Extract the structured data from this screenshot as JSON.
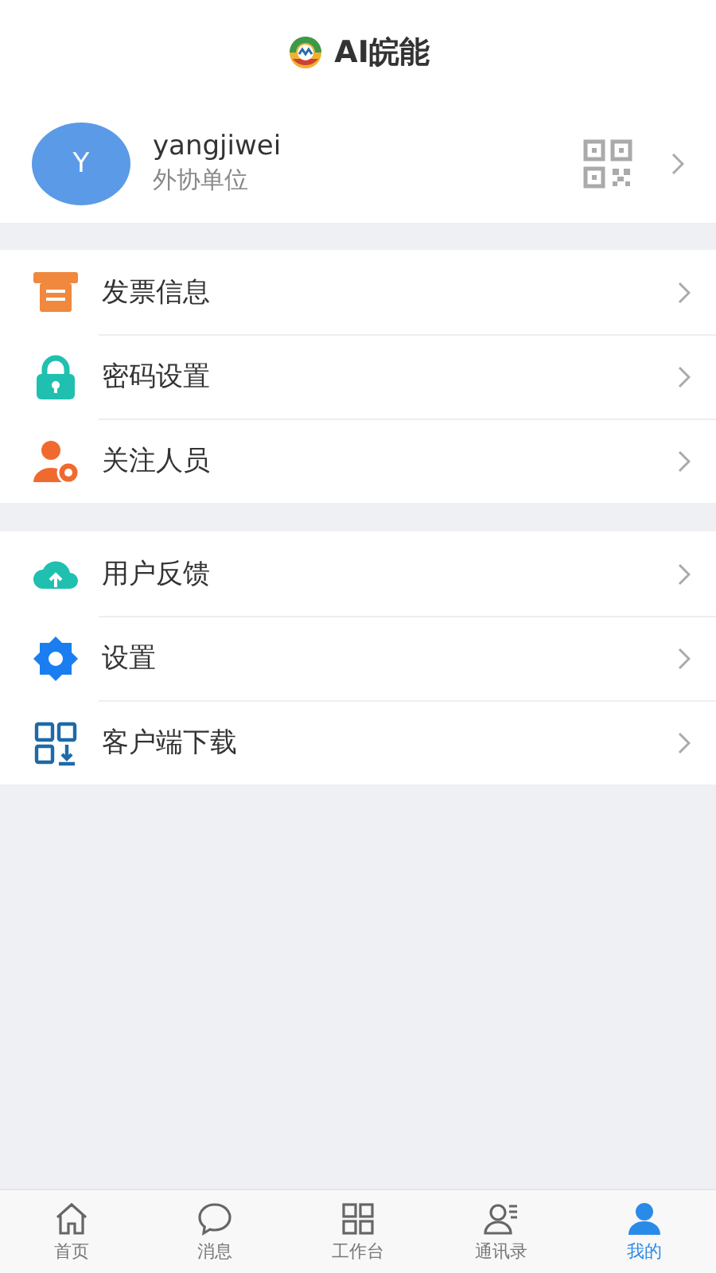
{
  "header": {
    "logo_text": "AI皖能"
  },
  "profile": {
    "avatar_letter": "Y",
    "name": "yangjiwei",
    "organization": "外协单位"
  },
  "menu_groups": [
    {
      "items": [
        {
          "kind": "invoice",
          "label": "发票信息"
        },
        {
          "kind": "lock",
          "label": "密码设置"
        },
        {
          "kind": "person-star",
          "label": "关注人员"
        }
      ]
    },
    {
      "items": [
        {
          "kind": "cloud",
          "label": "用户反馈"
        },
        {
          "kind": "gear",
          "label": "设置"
        },
        {
          "kind": "qr-download",
          "label": "客户端下载"
        }
      ]
    }
  ],
  "tabs": [
    {
      "kind": "home",
      "label": "首页",
      "selected": false
    },
    {
      "kind": "chat",
      "label": "消息",
      "selected": false
    },
    {
      "kind": "grid",
      "label": "工作台",
      "selected": false
    },
    {
      "kind": "contacts",
      "label": "通讯录",
      "selected": false
    },
    {
      "kind": "person",
      "label": "我的",
      "selected": true
    }
  ]
}
